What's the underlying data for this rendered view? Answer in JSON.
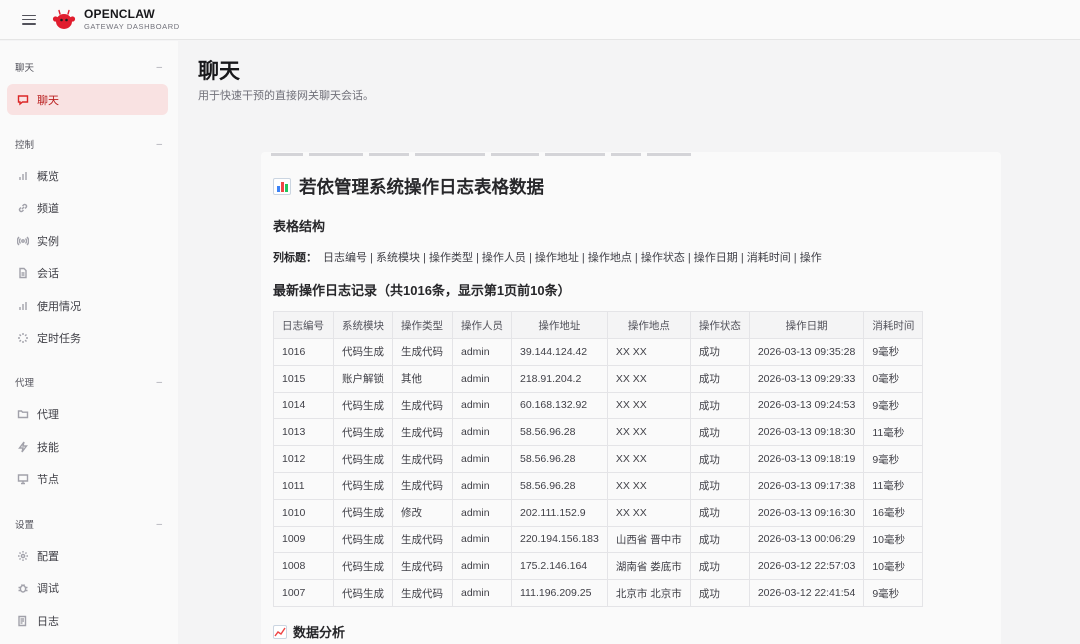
{
  "brand": {
    "name": "OPENCLAW",
    "subtitle": "GATEWAY DASHBOARD"
  },
  "sidebar": {
    "groups": [
      {
        "label": "聊天",
        "items": [
          {
            "label": "聊天",
            "icon": "chat-icon",
            "active": true
          }
        ]
      },
      {
        "label": "控制",
        "items": [
          {
            "label": "概览",
            "icon": "bar-chart-icon"
          },
          {
            "label": "频道",
            "icon": "link-icon"
          },
          {
            "label": "实例",
            "icon": "broadcast-icon"
          },
          {
            "label": "会话",
            "icon": "document-icon"
          },
          {
            "label": "使用情况",
            "icon": "bar-chart-icon"
          },
          {
            "label": "定时任务",
            "icon": "loader-icon"
          }
        ]
      },
      {
        "label": "代理",
        "items": [
          {
            "label": "代理",
            "icon": "folder-icon"
          },
          {
            "label": "技能",
            "icon": "lightning-icon"
          },
          {
            "label": "节点",
            "icon": "monitor-icon"
          }
        ]
      },
      {
        "label": "设置",
        "items": [
          {
            "label": "配置",
            "icon": "gear-icon"
          },
          {
            "label": "调试",
            "icon": "bug-icon"
          },
          {
            "label": "日志",
            "icon": "log-icon"
          }
        ]
      }
    ]
  },
  "page": {
    "title": "聊天",
    "subtitle": "用于快速干预的直接网关聊天会话。"
  },
  "message": {
    "title": "若依管理系统操作日志表格数据",
    "structure_heading": "表格结构",
    "columns_label": "列标题：",
    "columns_text": "日志编号 | 系统模块 | 操作类型 | 操作人员 | 操作地址 | 操作地点 | 操作状态 | 操作日期 | 消耗时间 | 操作",
    "latest_heading": "最新操作日志记录（共1016条，显示第1页前10条）",
    "analysis_heading": "数据分析",
    "table": {
      "headers": [
        "日志编号",
        "系统模块",
        "操作类型",
        "操作人员",
        "操作地址",
        "操作地点",
        "操作状态",
        "操作日期",
        "消耗时间"
      ],
      "rows": [
        [
          "1016",
          "代码生成",
          "生成代码",
          "admin",
          "39.144.124.42",
          "XX XX",
          "成功",
          "2026-03-13 09:35:28",
          "9毫秒"
        ],
        [
          "1015",
          "账户解锁",
          "其他",
          "admin",
          "218.91.204.2",
          "XX XX",
          "成功",
          "2026-03-13 09:29:33",
          "0毫秒"
        ],
        [
          "1014",
          "代码生成",
          "生成代码",
          "admin",
          "60.168.132.92",
          "XX XX",
          "成功",
          "2026-03-13 09:24:53",
          "9毫秒"
        ],
        [
          "1013",
          "代码生成",
          "生成代码",
          "admin",
          "58.56.96.28",
          "XX XX",
          "成功",
          "2026-03-13 09:18:30",
          "11毫秒"
        ],
        [
          "1012",
          "代码生成",
          "生成代码",
          "admin",
          "58.56.96.28",
          "XX XX",
          "成功",
          "2026-03-13 09:18:19",
          "9毫秒"
        ],
        [
          "1011",
          "代码生成",
          "生成代码",
          "admin",
          "58.56.96.28",
          "XX XX",
          "成功",
          "2026-03-13 09:17:38",
          "11毫秒"
        ],
        [
          "1010",
          "代码生成",
          "修改",
          "admin",
          "202.111.152.9",
          "XX XX",
          "成功",
          "2026-03-13 09:16:30",
          "16毫秒"
        ],
        [
          "1009",
          "代码生成",
          "生成代码",
          "admin",
          "220.194.156.183",
          "山西省 晋中市",
          "成功",
          "2026-03-13 00:06:29",
          "10毫秒"
        ],
        [
          "1008",
          "代码生成",
          "生成代码",
          "admin",
          "175.2.146.164",
          "湖南省 娄底市",
          "成功",
          "2026-03-12 22:57:03",
          "10毫秒"
        ],
        [
          "1007",
          "代码生成",
          "生成代码",
          "admin",
          "111.196.209.25",
          "北京市 北京市",
          "成功",
          "2026-03-12 22:41:54",
          "9毫秒"
        ]
      ]
    }
  },
  "colors": {
    "accent": "#dc2626",
    "active_bg": "#f9e2e2"
  }
}
